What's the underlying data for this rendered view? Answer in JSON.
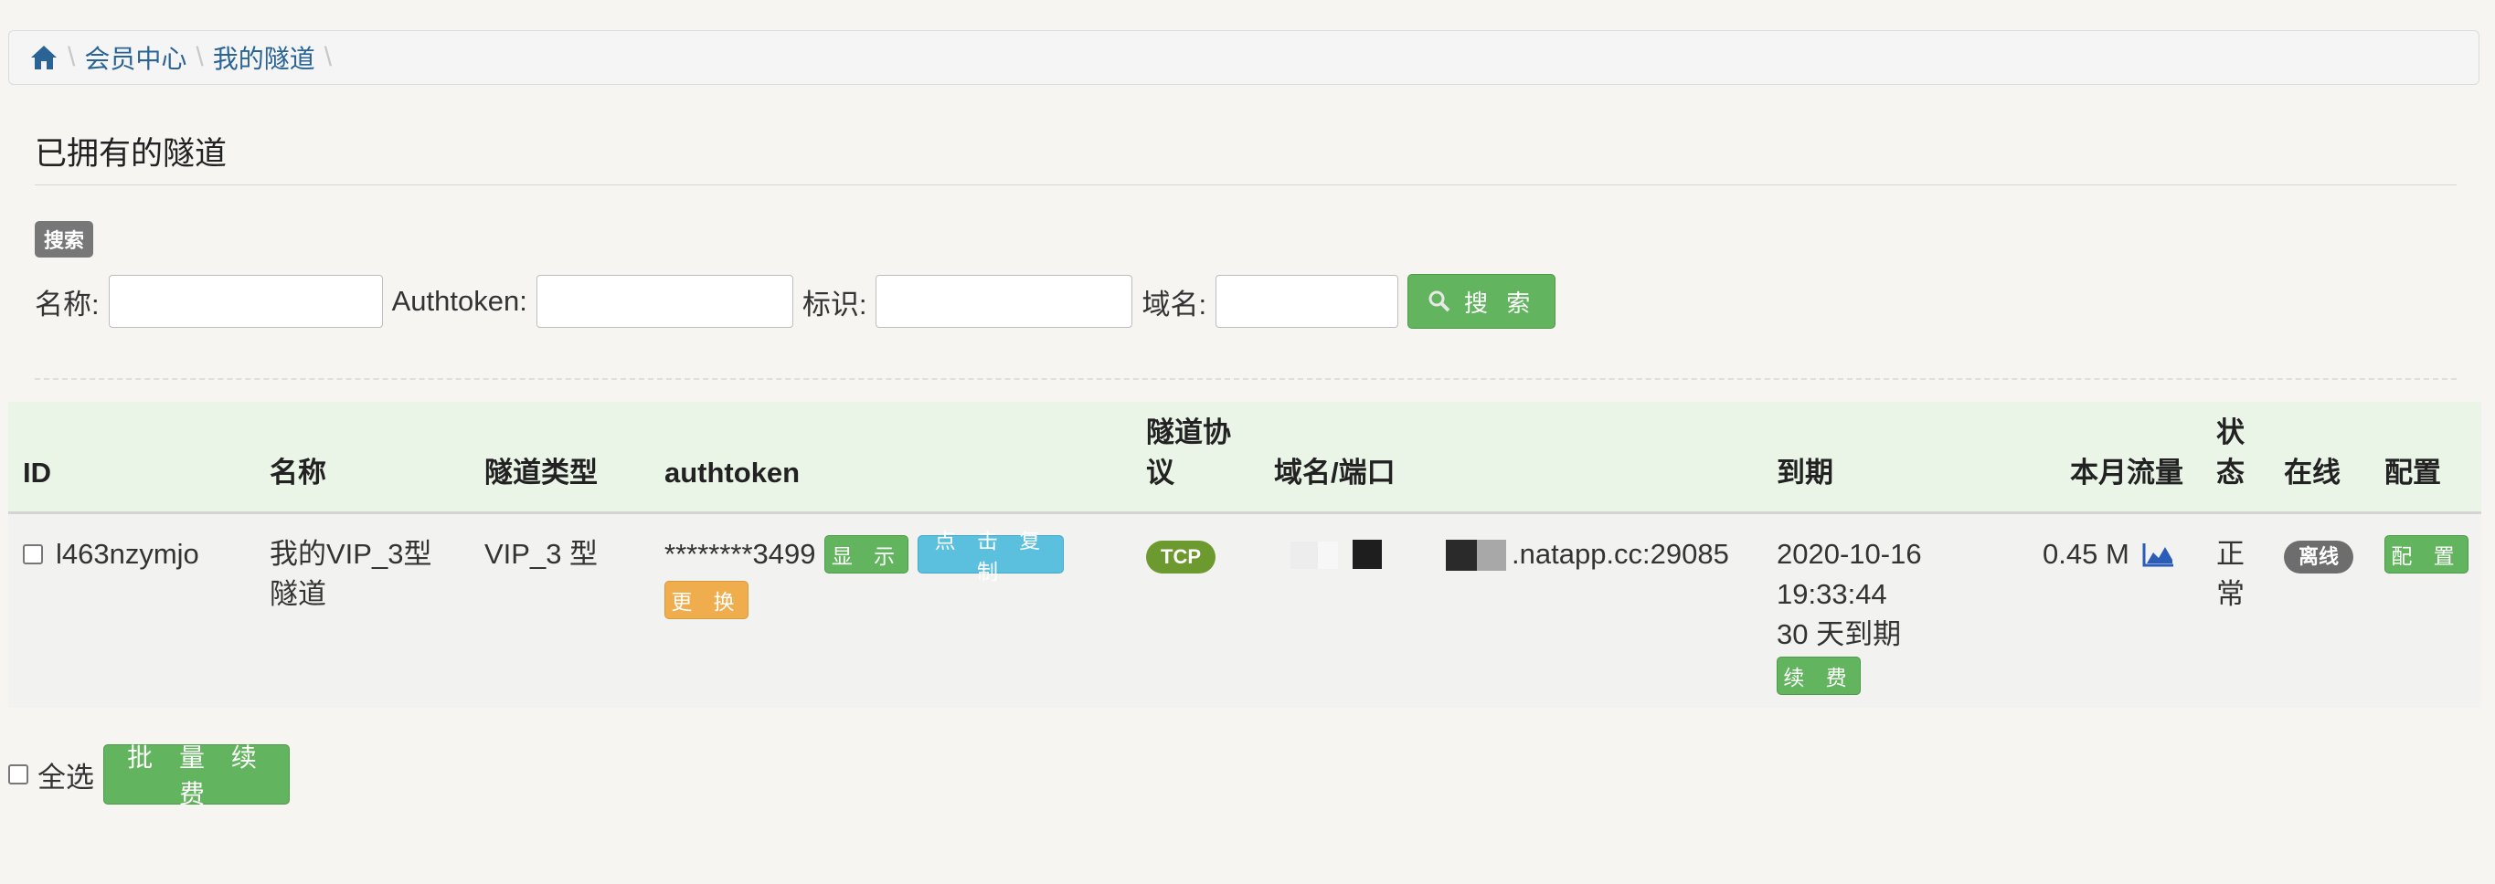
{
  "breadcrumb": {
    "home_icon": "home-icon",
    "items": [
      "会员中心",
      "我的隧道"
    ]
  },
  "page_title": "已拥有的隧道",
  "search": {
    "badge": "搜索",
    "name_label": "名称:",
    "name_value": "",
    "authtoken_label": "Authtoken:",
    "authtoken_value": "",
    "tag_label": "标识:",
    "tag_value": "",
    "domain_label": "域名:",
    "domain_value": "",
    "button_label": "搜 索"
  },
  "table": {
    "headers": {
      "id": "ID",
      "name": "名称",
      "type": "隧道类型",
      "authtoken": "authtoken",
      "protocol_line1": "隧道协",
      "protocol_line2": "议",
      "domain": "域名/端口",
      "expire": "到期",
      "traffic": "本月流量",
      "status_line1": "状",
      "status_line2": "态",
      "online": "在线",
      "config": "配置"
    },
    "rows": [
      {
        "id": "l463nzymjo",
        "name_line1": "我的VIP_3型",
        "name_line2": "隧道",
        "type": "VIP_3 型",
        "authtoken": "********3499",
        "show_button": "显 示",
        "copy_button": "点 击 复 制",
        "change_button": "更 换",
        "protocol": "TCP",
        "domain_suffix": ".natapp.cc:29085",
        "expire_date": "2020-10-16",
        "expire_time": "19:33:44",
        "expire_days": "30 天到期",
        "renew_button": "续 费",
        "traffic": "0.45 M",
        "status_line1": "正",
        "status_line2": "常",
        "online": "离线",
        "config_button": "配 置"
      }
    ]
  },
  "footer": {
    "select_all_label": "全选",
    "batch_renew_button": "批 量 续 费"
  },
  "colors": {
    "link": "#2a6496",
    "success": "#62b45e",
    "info": "#5bc0de",
    "warning": "#f0ad4e",
    "header_bg": "#eaf5e8"
  }
}
